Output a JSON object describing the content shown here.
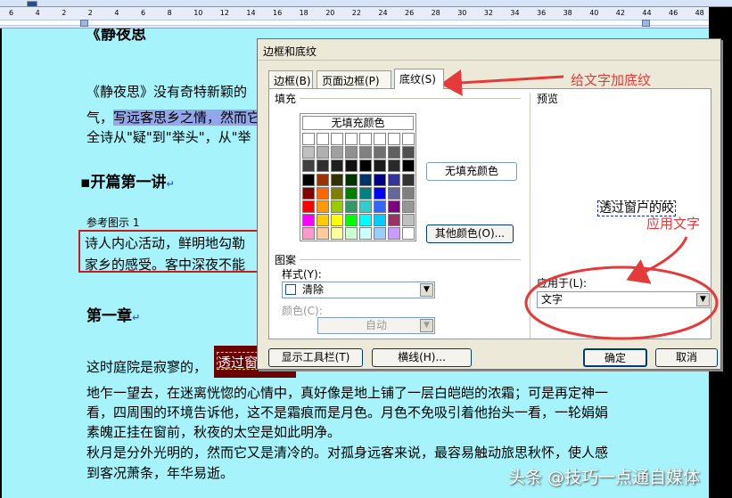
{
  "ruler": {
    "ticks": [
      "6",
      "4",
      "2",
      "2",
      "4",
      "6",
      "8",
      "10",
      "12",
      "14",
      "16",
      "18",
      "20",
      "22",
      "24",
      "26",
      "28",
      "30",
      "32",
      "34",
      "36",
      "38",
      "40",
      "42",
      "44",
      "46",
      "48"
    ]
  },
  "document": {
    "title_fragment": "《静夜思",
    "para1": "《静夜思》没有奇特新颖的",
    "para2_plain": "气，",
    "para2_highlight": "写远客思乡之情，然而它",
    "para3": "全诗从\"疑\"到\"举头\"，从\"举",
    "heading1": "开篇第一讲",
    "caption": "参考图示  1",
    "box_line1": "诗人内心活动，鲜明地勾勒",
    "box_line2": "家乡的感受。客中深夜不能",
    "heading2": "第一章",
    "para4_prefix": "这时庭院是寂寥的，",
    "shaded_text": "透过窗",
    "body_lines": [
      "地乍一望去，在迷离恍惚的心情中，真好像是地上铺了一层白皑皑的浓霜；可是再定神一",
      "看，四周围的环境告诉他，这不是霜痕而是月色。月色不免吸引着他抬头一看，一轮娟娟",
      "素魄正挂在窗前，秋夜的太空是如此明净。",
      "秋月是分外光明的，然而它又是清冷的。对孤身远客来说，最容易触动旅思秋怀，使人感",
      "到客况萧条，年华易逝。"
    ]
  },
  "dialog": {
    "title": "边框和底纹",
    "tabs": [
      "边框(B)",
      "页面边框(P)",
      "底纹(S)"
    ],
    "active_tab": 2,
    "fill_label": "填充",
    "no_fill_top": "无填充颜色",
    "no_fill_display": "无填充颜色",
    "more_colors": "其他颜色(O)...",
    "pattern_label": "图案",
    "style_label": "样式(Y):",
    "style_value": "清除",
    "color_label": "颜色(C):",
    "color_value": "自动",
    "preview_label": "预览",
    "preview_text": "透过窗户的皎",
    "apply_to_label": "应用于(L):",
    "apply_to_value": "文字",
    "show_toolbar": "显示工具栏(T)",
    "horizontal_line": "横线(H)...",
    "ok": "确定",
    "cancel": "取消",
    "palette": [
      [
        "#ffffff",
        "#ffffff",
        "#ffffff",
        "#ffffff",
        "#ffffff",
        "#ffffff",
        "#ffffff",
        "#ffffff"
      ],
      [
        "#c0c0c0",
        "#b0b0b0",
        "#a0a0a0",
        "#909090",
        "#808080",
        "#707070",
        "#606060",
        "#505050"
      ],
      [
        "#404040",
        "#303030",
        "#202020",
        "#101010",
        "#000000",
        "#1a1a1a",
        "#2a2a2a",
        "#000000"
      ],
      [
        "#000000",
        "#993300",
        "#333300",
        "#003300",
        "#003366",
        "#000080",
        "#333399",
        "#333333"
      ],
      [
        "#800000",
        "#ff6600",
        "#808000",
        "#008000",
        "#008080",
        "#0000ff",
        "#666699",
        "#808080"
      ],
      [
        "#ff0000",
        "#ff9900",
        "#99cc00",
        "#339966",
        "#33cccc",
        "#3366ff",
        "#800080",
        "#969696"
      ],
      [
        "#ff00ff",
        "#ffcc00",
        "#ffff00",
        "#00ff00",
        "#00ffff",
        "#00ccff",
        "#993366",
        "#c0c0c0"
      ],
      [
        "#ff99cc",
        "#ffcc99",
        "#ffff99",
        "#ccffcc",
        "#ccffff",
        "#99ccff",
        "#cc99ff",
        "#ffffff"
      ]
    ]
  },
  "annotations": {
    "tab_note": "给文字加底纹",
    "apply_note": "应用文字",
    "color": "#e63a3a"
  },
  "watermark": "头条 @技巧一点通自媒体"
}
